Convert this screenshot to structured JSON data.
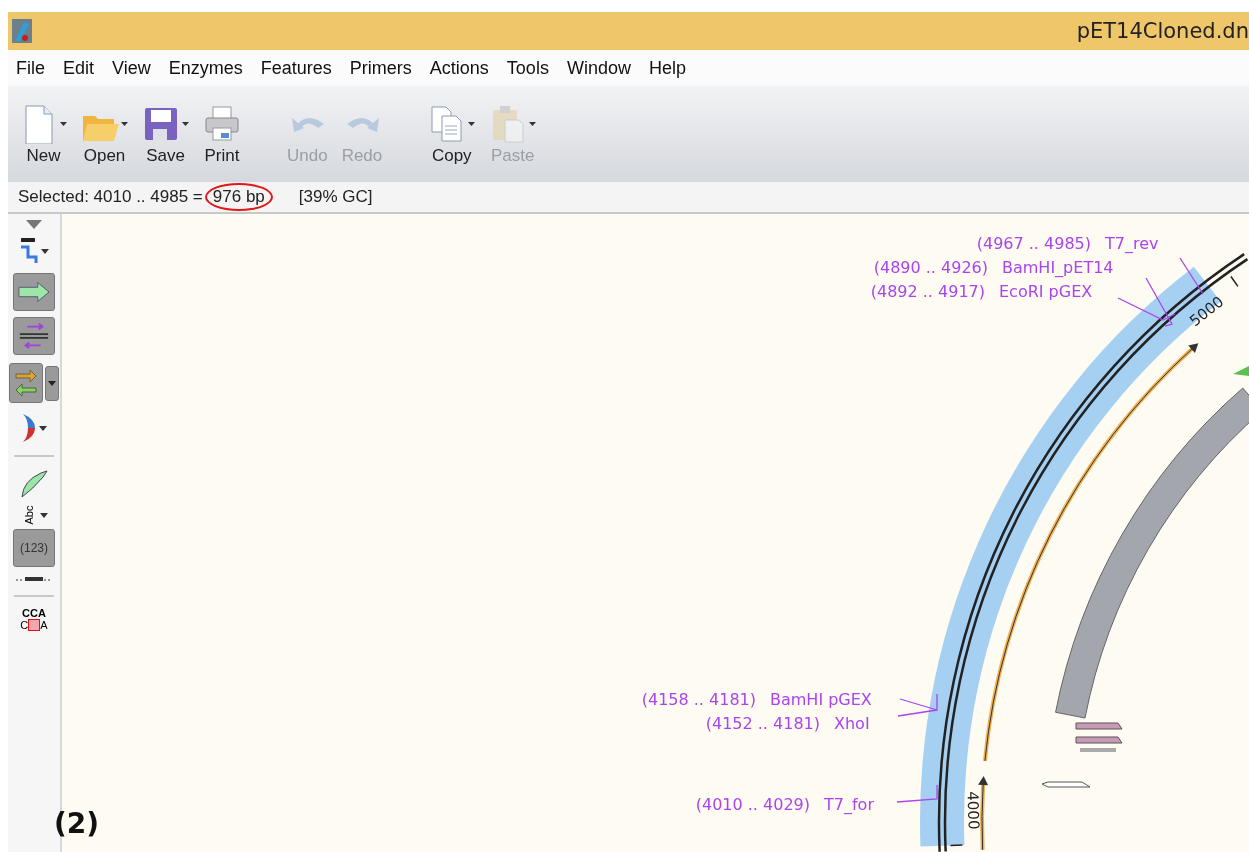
{
  "window": {
    "title": "pET14Cloned.dn"
  },
  "menu": [
    "File",
    "Edit",
    "View",
    "Enzymes",
    "Features",
    "Primers",
    "Actions",
    "Tools",
    "Window",
    "Help"
  ],
  "toolbar": [
    {
      "kind": "new",
      "label": "New",
      "disabled": false,
      "has_menu": true
    },
    {
      "kind": "open",
      "label": "Open",
      "disabled": false,
      "has_menu": true
    },
    {
      "kind": "save",
      "label": "Save",
      "disabled": false,
      "has_menu": true
    },
    {
      "kind": "print",
      "label": "Print",
      "disabled": false,
      "has_menu": false
    },
    {
      "kind": "undo",
      "label": "Undo",
      "disabled": true,
      "has_menu": false
    },
    {
      "kind": "redo",
      "label": "Redo",
      "disabled": true,
      "has_menu": false
    },
    {
      "kind": "copy",
      "label": "Copy",
      "disabled": false,
      "has_menu": true
    },
    {
      "kind": "paste",
      "label": "Paste",
      "disabled": true,
      "has_menu": true
    }
  ],
  "status_bar": [
    {
      "text": "Selected:  4010 .. 4985 =",
      "circled": false
    },
    {
      "text": "976 bp",
      "circled": true
    },
    {
      "text": "[39% GC]",
      "circled": false
    }
  ],
  "side_tools": [
    {
      "kind": "collapse"
    },
    {
      "kind": "route",
      "on": false,
      "has_menu": true
    },
    {
      "kind": "feature",
      "on": true
    },
    {
      "kind": "primer",
      "on": true
    },
    {
      "kind": "orf",
      "on": true,
      "has_menu": true
    },
    {
      "kind": "bracket",
      "on": false,
      "has_menu": true
    },
    {
      "kind": "divider"
    },
    {
      "kind": "leaf",
      "on": false
    },
    {
      "kind": "abc",
      "on": false,
      "text": "Abc",
      "has_menu": true
    },
    {
      "kind": "numbers",
      "on": true,
      "text": "(123)"
    },
    {
      "kind": "line",
      "on": false
    },
    {
      "kind": "divider"
    },
    {
      "kind": "sequence",
      "top": "CCA",
      "bottom_left": "C",
      "bottom_right": "A"
    }
  ],
  "map": {
    "ticks": [
      "5000",
      "4000"
    ],
    "labels": [
      {
        "range": "(4967 .. 4985)",
        "name": "T7_rev"
      },
      {
        "range": "(4890 .. 4926)",
        "name": "BamHI_pET14"
      },
      {
        "range": "(4892 .. 4917)",
        "name": "EcoRI pGEX"
      },
      {
        "range": "(4158 .. 4181)",
        "name": "BamHI pGEX"
      },
      {
        "range": "(4152 .. 4181)",
        "name": "XhoI"
      },
      {
        "range": "(4010 .. 4029)",
        "name": "T7_for"
      }
    ]
  },
  "figure_label": "(2)"
}
